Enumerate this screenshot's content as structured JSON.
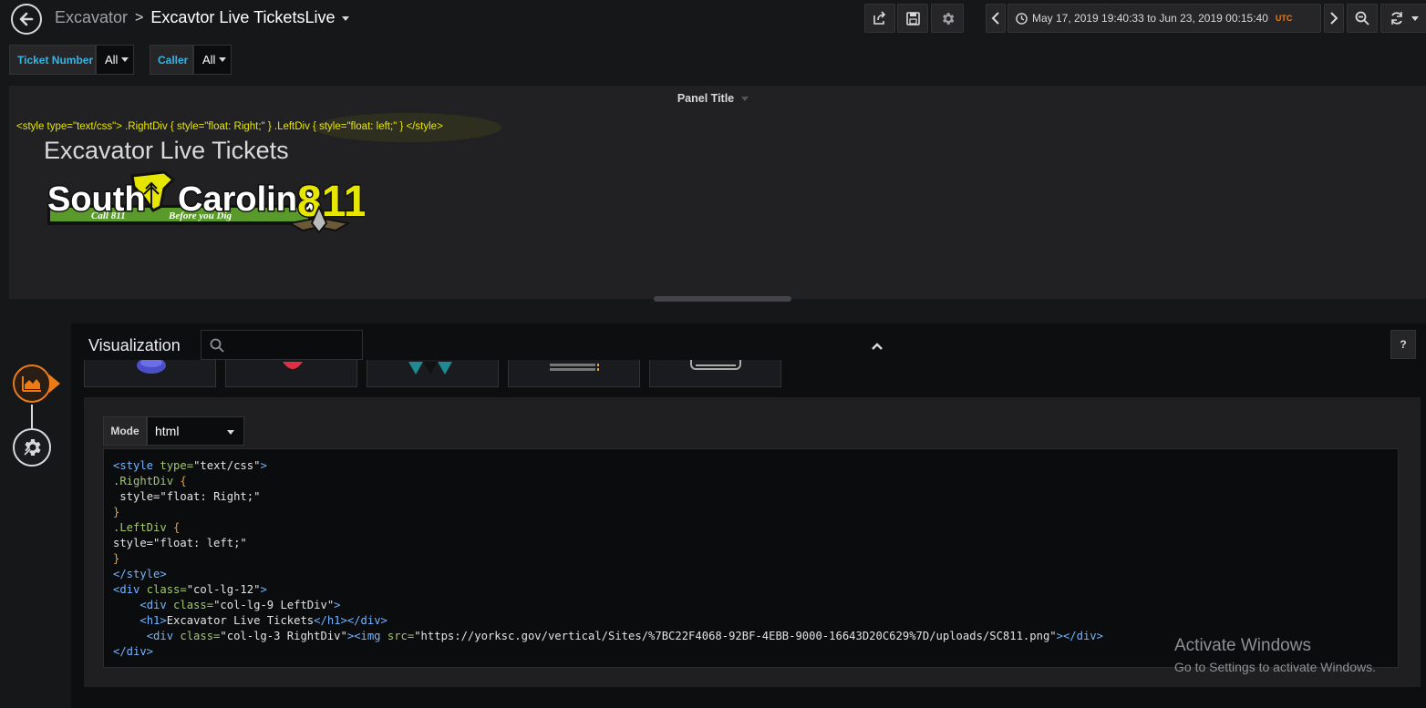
{
  "navbar": {
    "folder": "Excavator",
    "separator": ">",
    "dashboard_title": "Excavtor Live TicketsLive",
    "time_range": "May 17, 2019 19:40:33 to Jun 23, 2019 00:15:40",
    "timezone": "UTC"
  },
  "variables": [
    {
      "label": "Ticket Number",
      "value": "All"
    },
    {
      "label": "Caller",
      "value": "All"
    }
  ],
  "panel": {
    "title": "Panel Title",
    "raw_style_text": "<style type=\"text/css\"> .RightDiv { style=\"float: Right;\" } .LeftDiv { style=\"float: left;\" } </style>",
    "heading": "Excavator Live Tickets",
    "logo": {
      "word1": "South",
      "word2": "Carolina",
      "number": "811",
      "tagline1": "Call 811",
      "tagline2": "Before you Dig"
    }
  },
  "editor": {
    "section_title": "Visualization",
    "search_placeholder": "",
    "help_label": "?",
    "mode_label": "Mode",
    "mode_value": "html"
  },
  "watermark": {
    "title": "Activate Windows",
    "subtitle": "Go to Settings to activate Windows."
  },
  "colors": {
    "accent_blue": "#33b5e5",
    "accent_orange": "#eb7b18",
    "logo_yellow": "#e6e600",
    "logo_green": "#5a9a2a"
  }
}
